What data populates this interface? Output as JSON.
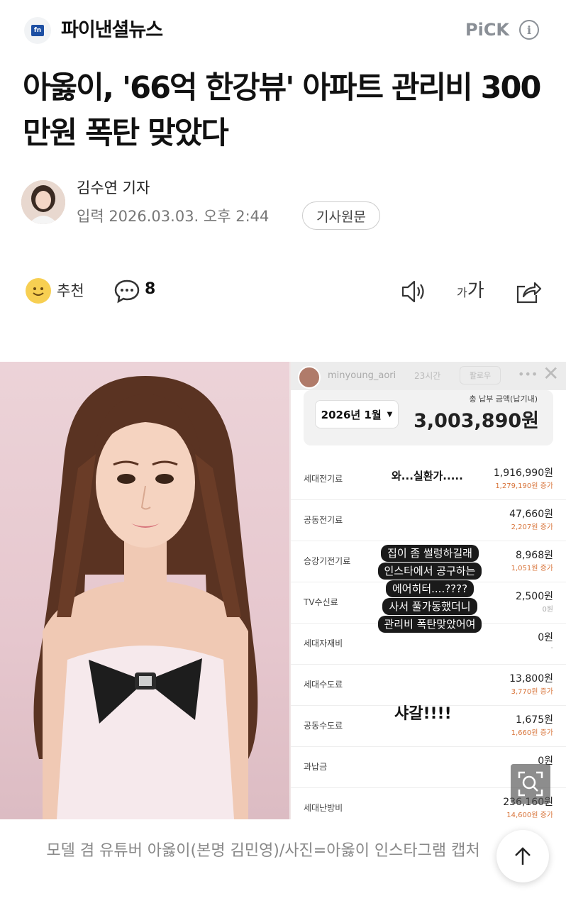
{
  "header": {
    "logo_text": "fn",
    "brand_name": "파이낸셜뉴스",
    "pick_label": "PiCK",
    "info_icon": "info-icon"
  },
  "article": {
    "headline": "아옳이, '66억 한강뷰' 아파트 관리비 300만원 폭탄 맞았다",
    "author": "김수연 기자",
    "date": "입력 2026.03.03. 오후 2:44",
    "original_button": "기사원문"
  },
  "actions": {
    "recommend_label": "추천",
    "comment_count": "8",
    "font_small": "가",
    "font_large": "가"
  },
  "story": {
    "username": "minyoung_aori",
    "time": "23시간",
    "follow_label": "팔로우",
    "month": "2026년 1월",
    "total_label": "총 납부 금액(납기내)",
    "total_amount": "3,003,890원",
    "rows": [
      {
        "label": "세대전기료",
        "amount": "1,916,990원",
        "diff": "1,279,190원 증가"
      },
      {
        "label": "공동전기료",
        "amount": "47,660원",
        "diff": "2,207원 증가"
      },
      {
        "label": "승강기전기료",
        "amount": "8,968원",
        "diff": "1,051원 증가"
      },
      {
        "label": "TV수신료",
        "amount": "2,500원",
        "diff": "0원"
      },
      {
        "label": "세대자재비",
        "amount": "0원",
        "diff": "-"
      },
      {
        "label": "세대수도료",
        "amount": "13,800원",
        "diff": "3,770원 증가"
      },
      {
        "label": "공동수도료",
        "amount": "1,675원",
        "diff": "1,660원 증가"
      },
      {
        "label": "과납금",
        "amount": "0원",
        "diff": ""
      },
      {
        "label": "세대난방비",
        "amount": "236,160원",
        "diff": "14,600원 증가"
      }
    ],
    "overlay_wow": "와...실환가.....",
    "overlay_bubble": [
      "집이 좀 썰렁하길래",
      "인스타에서 공구하는",
      "에어히터....????",
      "사서 풀가동했더니",
      "관리비 폭탄맞았어여"
    ],
    "overlay_shock": "샤갈!!!!"
  },
  "caption": "모델 겸 유튜버 아옳이(본명 김민영)/사진=아옳이 인스타그램 캡처"
}
